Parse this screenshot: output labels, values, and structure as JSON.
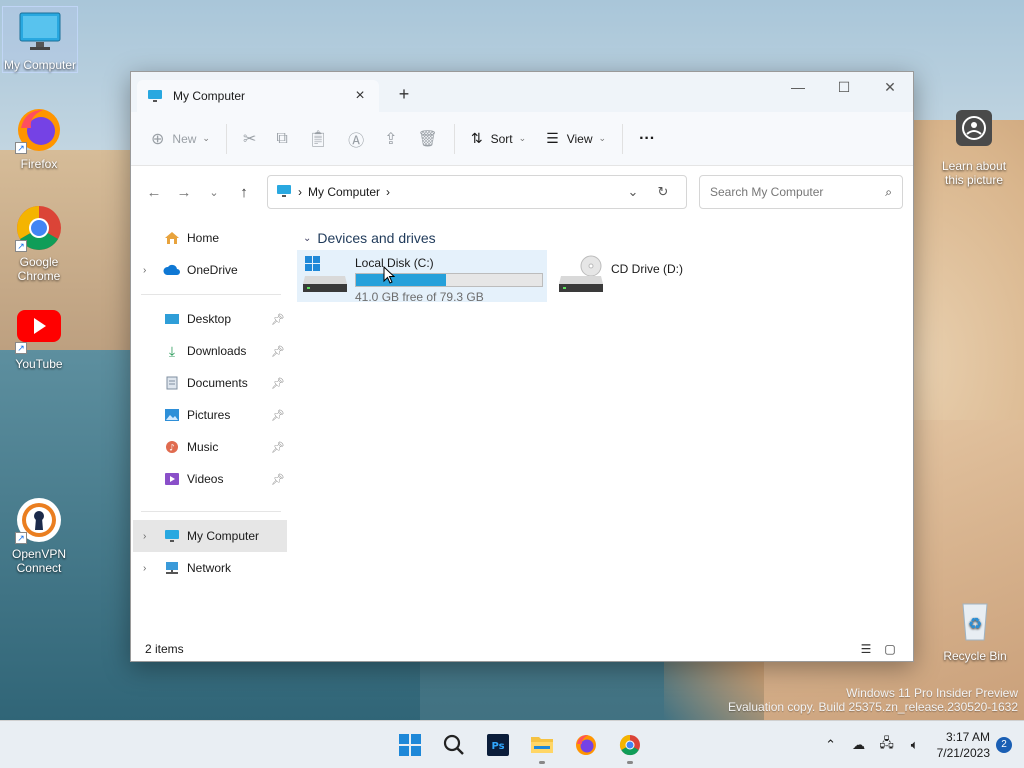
{
  "desktop": {
    "icons": [
      {
        "label": "My Computer"
      },
      {
        "label": "Firefox"
      },
      {
        "label": "Google Chrome"
      },
      {
        "label": "YouTube"
      },
      {
        "label": "OpenVPN Connect"
      },
      {
        "label": "Learn about this picture"
      },
      {
        "label": "Recycle Bin"
      }
    ],
    "watermark_line1": "Windows 11 Pro Insider Preview",
    "watermark_line2": "Evaluation copy. Build 25375.zn_release.230520-1632"
  },
  "window": {
    "tab_title": "My Computer",
    "controls": {
      "minimize": "—",
      "maximize": "☐",
      "close": "✕"
    },
    "toolbar": {
      "new_label": "New",
      "sort_label": "Sort",
      "view_label": "View",
      "more_label": "···"
    },
    "address": {
      "crumb": "My Computer",
      "search_placeholder": "Search My Computer"
    },
    "sidebar": {
      "home": "Home",
      "onedrive": "OneDrive",
      "quick": [
        "Desktop",
        "Downloads",
        "Documents",
        "Pictures",
        "Music",
        "Videos"
      ],
      "my_computer": "My Computer",
      "network": "Network"
    },
    "content": {
      "group_title": "Devices and drives",
      "drives": [
        {
          "name": "Local Disk (C:)",
          "free_text": "41.0 GB free of 79.3 GB",
          "used_fraction": 0.483
        },
        {
          "name": "CD Drive (D:)"
        }
      ]
    },
    "status": {
      "items": "2 items"
    }
  },
  "taskbar": {
    "time": "3:17 AM",
    "date": "7/21/2023",
    "notifications": "2"
  }
}
